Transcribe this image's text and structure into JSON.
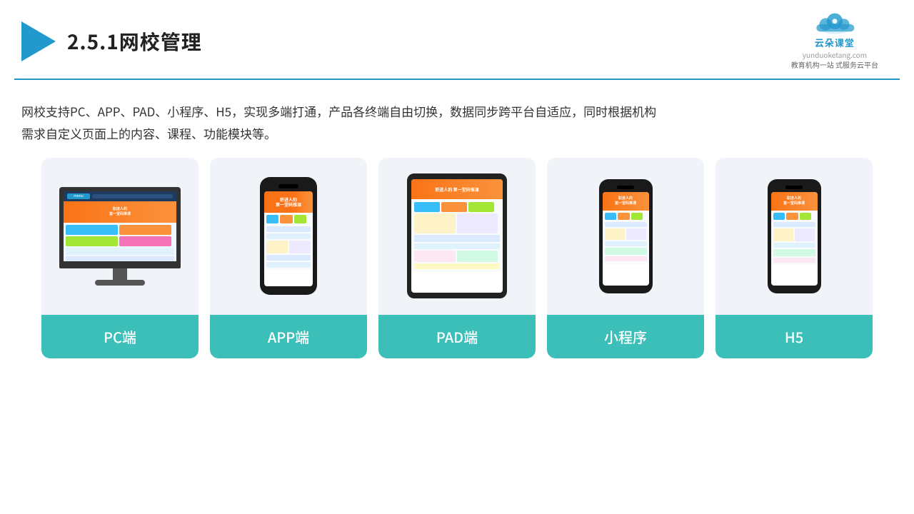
{
  "header": {
    "title": "2.5.1网校管理",
    "logo_name": "云朵课堂",
    "logo_url": "yunduoketang.com",
    "logo_tagline": "教育机构一站\n式服务云平台"
  },
  "description": {
    "text": "网校支持PC、APP、PAD、小程序、H5，实现多端打通，产品各终端自由切换，数据同步跨平台自适应，同时根据机构需求自定义页面上的内容、课程、功能模块等。"
  },
  "cards": [
    {
      "id": "pc",
      "label": "PC端"
    },
    {
      "id": "app",
      "label": "APP端"
    },
    {
      "id": "pad",
      "label": "PAD端"
    },
    {
      "id": "miniapp",
      "label": "小程序"
    },
    {
      "id": "h5",
      "label": "H5"
    }
  ],
  "colors": {
    "accent": "#3bbfb8",
    "header_line": "#2196c4",
    "brand": "#2299cc",
    "title": "#222222",
    "text": "#333333"
  }
}
